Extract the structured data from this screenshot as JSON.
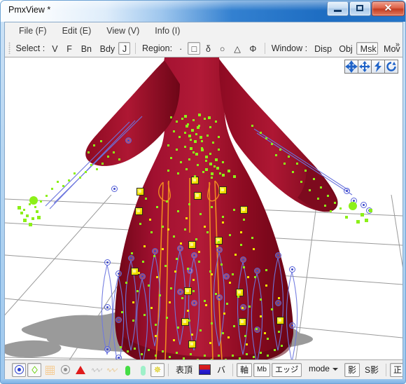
{
  "window": {
    "title": "PmxView *",
    "controls": {
      "minimize": "minimize-button",
      "maximize": "maximize-button",
      "close": "✕"
    }
  },
  "menubar": {
    "items": [
      {
        "label": "File (F)"
      },
      {
        "label": "Edit (E)"
      },
      {
        "label": "View (V)"
      },
      {
        "label": "Info (I)"
      }
    ]
  },
  "toolbar": {
    "select_label": "Select :",
    "select_buttons": [
      {
        "label": "V",
        "pressed": false
      },
      {
        "label": "F",
        "pressed": false
      },
      {
        "label": "Bn",
        "pressed": false
      },
      {
        "label": "Bdy",
        "pressed": false
      },
      {
        "label": "J",
        "pressed": true
      }
    ],
    "region_label": "Region:",
    "region_buttons": [
      {
        "label": "·",
        "pressed": false
      },
      {
        "label": "□",
        "pressed": true
      },
      {
        "label": "δ",
        "pressed": false
      },
      {
        "label": "○",
        "pressed": false
      },
      {
        "label": "△",
        "pressed": false
      },
      {
        "label": "Φ",
        "pressed": false
      }
    ],
    "window_label": "Window :",
    "window_buttons": [
      {
        "label": "Disp",
        "pressed": false
      },
      {
        "label": "Obj",
        "pressed": false
      },
      {
        "label": "Msk",
        "pressed": true
      },
      {
        "label": "Mov",
        "pressed": false
      }
    ],
    "overflow": "»"
  },
  "viewport": {
    "gizmo_buttons": [
      {
        "name": "move-gizmo-icon"
      },
      {
        "name": "pan-gizmo-icon"
      },
      {
        "name": "rotate-axis-gizmo-icon"
      },
      {
        "name": "rotate-view-gizmo-icon"
      }
    ],
    "background_color": "#ffffff",
    "grid_color": "#9a9a9a",
    "model_color": "#8d0a22",
    "vertex_color": "#8cf018",
    "selected_vertex_color": "#f2e400",
    "rigidbody_color": "#f6e500",
    "joint_color": "#5560d8",
    "bone_color": "#f08a20",
    "shadow_color": "#9a9a9a"
  },
  "statusbar": {
    "icon_buttons": [
      {
        "name": "vertex-display-toggle",
        "icon": "ring-icon",
        "pressed": true
      },
      {
        "name": "bone-display-toggle",
        "icon": "green-bone-icon",
        "pressed": true
      },
      {
        "name": "mesh-display-toggle",
        "icon": "mesh-icon",
        "pressed": false
      },
      {
        "name": "rigidbody-display-toggle",
        "icon": "ring-gray-icon",
        "pressed": false
      },
      {
        "name": "face-display-toggle",
        "icon": "red-triangle-icon",
        "pressed": false
      },
      {
        "name": "wave-display-toggle",
        "icon": "wave-gray-icon",
        "pressed": false
      },
      {
        "name": "wave2-display-toggle",
        "icon": "wave-tan-icon",
        "pressed": false
      },
      {
        "name": "capsule-display-toggle",
        "icon": "green-capsule-icon",
        "pressed": false
      },
      {
        "name": "capsule2-display-toggle",
        "icon": "pale-capsule-icon",
        "pressed": false
      },
      {
        "name": "gear-toggle",
        "icon": "gear-icon",
        "pressed": true
      }
    ],
    "text_buttons": [
      {
        "label": "表頂",
        "pressed": false,
        "name": "omote-chou-button"
      }
    ],
    "color_swatch": {
      "name": "material-color-swatch"
    },
    "buttons_right": [
      {
        "label": "バ",
        "pressed": false,
        "name": "ba-button"
      },
      {
        "label": "軸",
        "pressed": true,
        "name": "axis-button"
      },
      {
        "label": "Mb",
        "pressed": true,
        "name": "mb-button"
      },
      {
        "label": "エッジ゙",
        "pressed": true,
        "name": "edge-button"
      }
    ],
    "mode_combo": {
      "label": "mode",
      "name": "mode-combobox"
    },
    "buttons_far_right": [
      {
        "label": "影",
        "pressed": true,
        "name": "shadow-button"
      },
      {
        "label": "S影",
        "pressed": false,
        "name": "self-shadow-button"
      },
      {
        "label": "正",
        "pressed": true,
        "name": "ortho-button"
      }
    ]
  },
  "chart_data": null
}
